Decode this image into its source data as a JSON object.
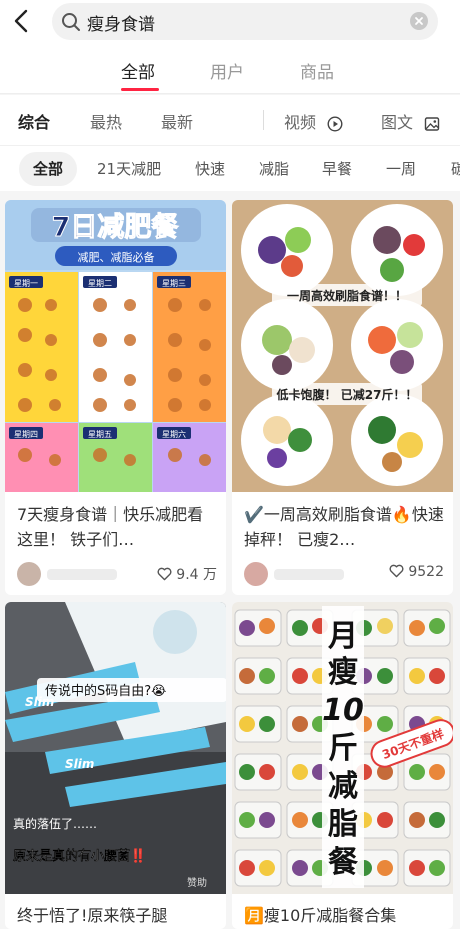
{
  "search": {
    "query": "瘦身食谱"
  },
  "main_tabs": [
    {
      "label": "全部"
    },
    {
      "label": "用户"
    },
    {
      "label": "商品"
    }
  ],
  "sort_tabs": [
    {
      "label": "综合"
    },
    {
      "label": "最热"
    },
    {
      "label": "最新"
    }
  ],
  "type_filters": [
    {
      "label": "视频",
      "icon": "play-circle-icon"
    },
    {
      "label": "图文",
      "icon": "image-icon"
    }
  ],
  "chips": [
    {
      "label": "全部"
    },
    {
      "label": "21天减肥"
    },
    {
      "label": "快速"
    },
    {
      "label": "减脂"
    },
    {
      "label": "早餐"
    },
    {
      "label": "一周"
    },
    {
      "label": "碳"
    }
  ],
  "cards": [
    {
      "cover": {
        "headline": "7日减肥餐",
        "tagline": "减肥、减脂必备",
        "days": [
          "星期一",
          "星期二",
          "星期三",
          "星期四",
          "星期五",
          "星期六"
        ]
      },
      "title": "7天瘦身食谱｜快乐减肥看这里！ 铁子们…",
      "likes": "9.4 万"
    },
    {
      "cover": {
        "banner1": "一周高效刷脂食谱！！",
        "banner2": "低卡饱腹！ 已减27斤！！"
      },
      "title": "✔️一周高效刷脂食谱🔥快速掉秤！ 已瘦2…",
      "likes": "9522"
    },
    {
      "cover": {
        "bubble": "传说中的S码自由?😭",
        "caption1": "真的落伍了……",
        "caption2": "原来是真的有小腰菌‼️",
        "ad_tag": "赞助",
        "brand": "Slim"
      },
      "title": "终于悟了!原来筷子腿"
    },
    {
      "cover": {
        "vertical_text": [
          "月",
          "瘦",
          "10",
          "斤",
          "减",
          "脂",
          "餐"
        ],
        "stamp": "30天不重样"
      },
      "title": "🈷️瘦10斤减脂餐合集"
    }
  ]
}
